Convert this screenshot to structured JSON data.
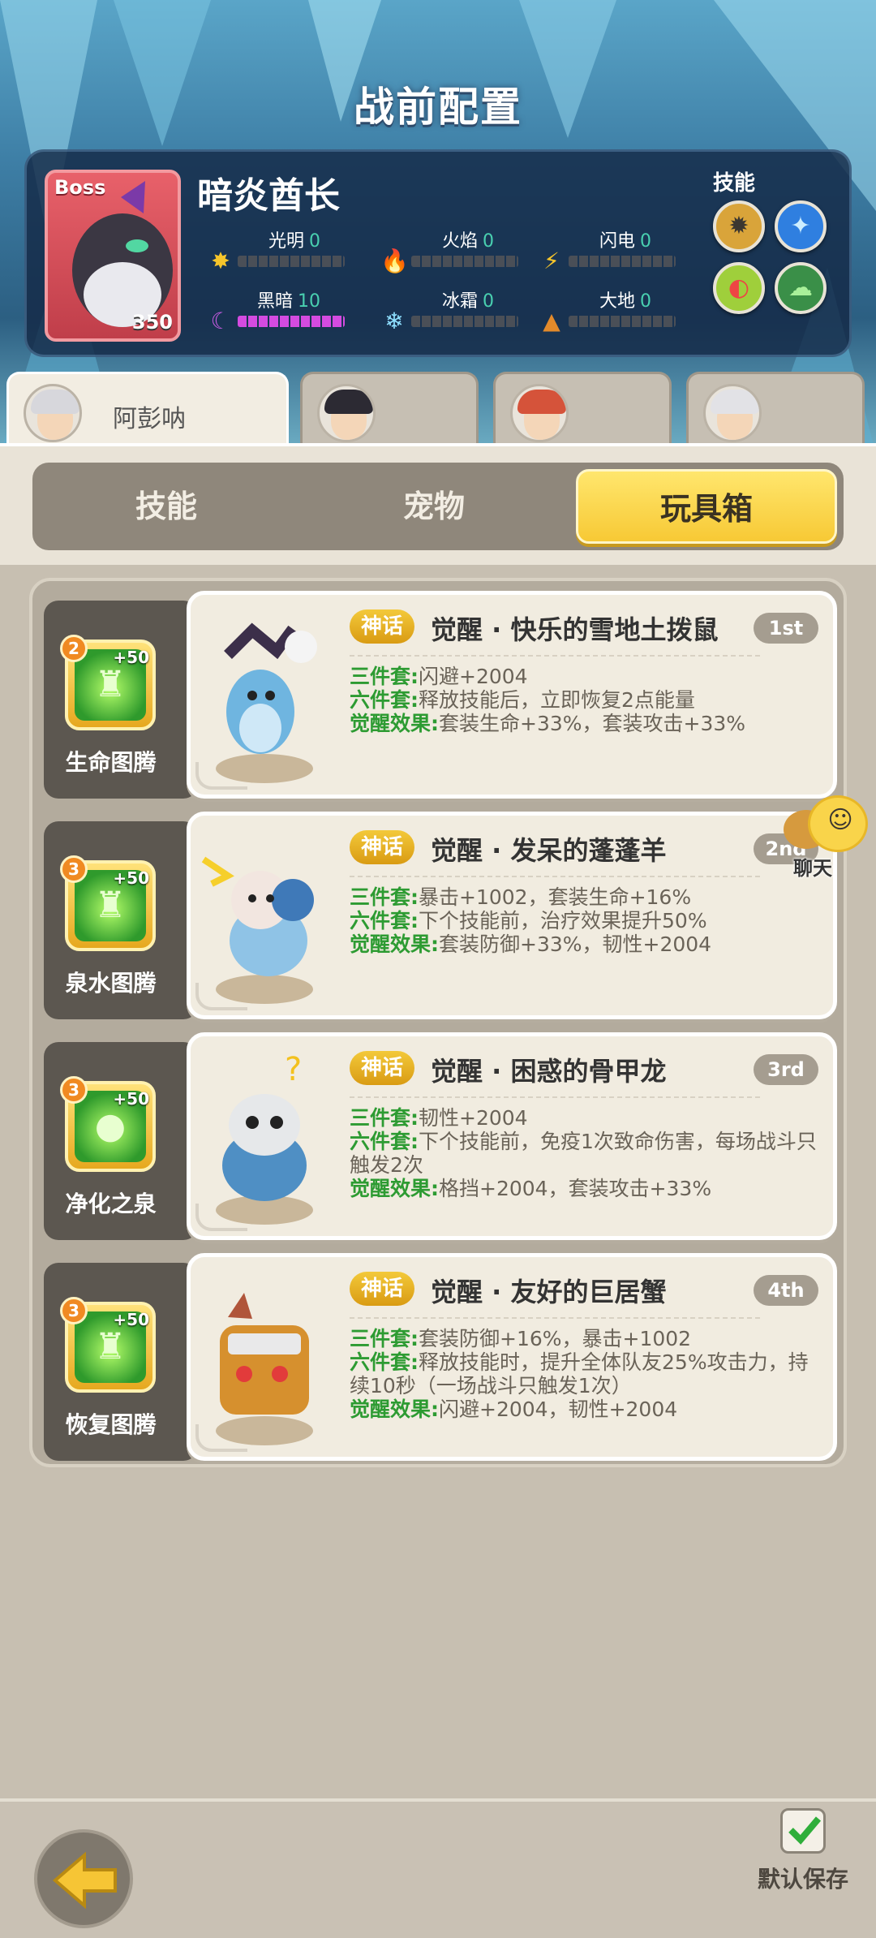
{
  "header": {
    "title": "战前配置"
  },
  "boss": {
    "tag": "Boss",
    "name": "暗炎酋长",
    "level": "350",
    "skills_label": "技能",
    "elements": [
      {
        "name": "光明",
        "value": "0",
        "icon": "sun-icon"
      },
      {
        "name": "火焰",
        "value": "0",
        "icon": "flame-icon"
      },
      {
        "name": "闪电",
        "value": "0",
        "icon": "lightning-icon"
      },
      {
        "name": "黑暗",
        "value": "10",
        "icon": "moon-icon"
      },
      {
        "name": "冰霜",
        "value": "0",
        "icon": "snowflake-icon"
      },
      {
        "name": "大地",
        "value": "0",
        "icon": "rock-icon"
      }
    ]
  },
  "heroes": [
    {
      "name": "阿彭呐",
      "active": true
    },
    {
      "name": "",
      "active": false
    },
    {
      "name": "",
      "active": false
    },
    {
      "name": "",
      "active": false
    }
  ],
  "category_tabs": [
    "技能",
    "宠物",
    "玩具箱"
  ],
  "active_category": "玩具箱",
  "toys": [
    {
      "totem_name": "生命图腾",
      "totem_level": "2",
      "totem_bonus": "+50",
      "rarity": "神话",
      "title": "觉醒 · 快乐的雪地土拨鼠",
      "rank": "1st",
      "effects": [
        {
          "label": "三件套:",
          "text": "闪避+2004"
        },
        {
          "label": "六件套:",
          "text": "释放技能后，立即恢复2点能量"
        },
        {
          "label": "觉醒效果:",
          "text": "套装生命+33%，套装攻击+33%"
        }
      ]
    },
    {
      "totem_name": "泉水图腾",
      "totem_level": "3",
      "totem_bonus": "+50",
      "rarity": "神话",
      "title": "觉醒 · 发呆的蓬蓬羊",
      "rank": "2nd",
      "effects": [
        {
          "label": "三件套:",
          "text": "暴击+1002，套装生命+16%"
        },
        {
          "label": "六件套:",
          "text": "下个技能前，治疗效果提升50%"
        },
        {
          "label": "觉醒效果:",
          "text": "套装防御+33%，韧性+2004"
        }
      ]
    },
    {
      "totem_name": "净化之泉",
      "totem_level": "3",
      "totem_bonus": "+50",
      "rarity": "神话",
      "title": "觉醒 · 困惑的骨甲龙",
      "rank": "3rd",
      "effects": [
        {
          "label": "三件套:",
          "text": "韧性+2004"
        },
        {
          "label": "六件套:",
          "text": "下个技能前，免疫1次致命伤害，每场战斗只触发2次"
        },
        {
          "label": "觉醒效果:",
          "text": "格挡+2004，套装攻击+33%"
        }
      ]
    },
    {
      "totem_name": "恢复图腾",
      "totem_level": "3",
      "totem_bonus": "+50",
      "rarity": "神话",
      "title": "觉醒 · 友好的巨居蟹",
      "rank": "4th",
      "effects": [
        {
          "label": "三件套:",
          "text": "套装防御+16%，暴击+1002"
        },
        {
          "label": "六件套:",
          "text": "释放技能时，提升全体队友25%攻击力，持续10秒（一场战斗只触发1次）"
        },
        {
          "label": "觉醒效果:",
          "text": "闪避+2004，韧性+2004"
        }
      ]
    }
  ],
  "chat": {
    "label": "聊天"
  },
  "footer": {
    "save_label": "默认保存",
    "save_checked": true
  }
}
